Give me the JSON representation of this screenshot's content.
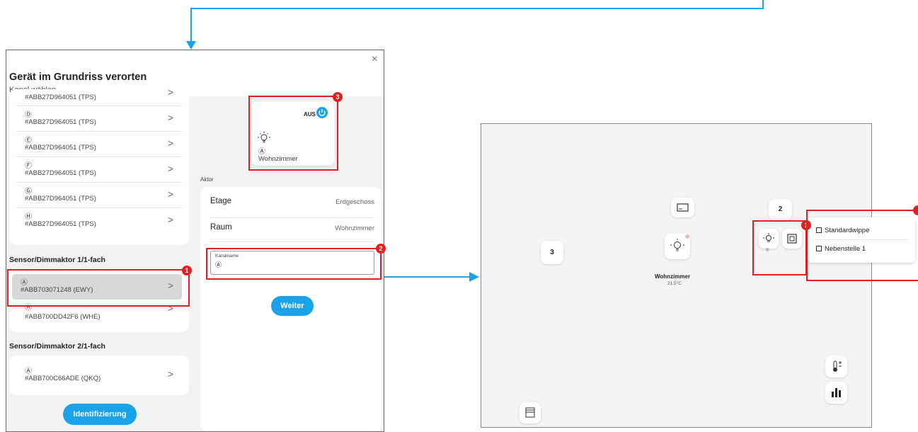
{
  "dialog": {
    "title": "Gerät im Grundriss verorten",
    "subtitle": "Kanal wählen",
    "close": "×"
  },
  "channel_list": {
    "top_partial_id": "#ABB27D964051 (TPS)",
    "group1_rows": [
      {
        "channel": "Ⓓ",
        "id": "#ABB27D964051 (TPS)"
      },
      {
        "channel": "Ⓔ",
        "id": "#ABB27D964051 (TPS)"
      },
      {
        "channel": "Ⓕ",
        "id": "#ABB27D964051 (TPS)"
      },
      {
        "channel": "Ⓖ",
        "id": "#ABB27D964051 (TPS)"
      },
      {
        "channel": "Ⓗ",
        "id": "#ABB27D964051 (TPS)"
      }
    ],
    "section2_title": "Sensor/Dimmaktor 1/1-fach",
    "group2_rows": [
      {
        "channel": "Ⓐ",
        "id": "#ABB703071248 (EWY)"
      },
      {
        "channel": "Ⓐ",
        "id": "#ABB700DD42F6 (WHE)"
      }
    ],
    "section3_title": "Sensor/Dimmaktor 2/1-fach",
    "group3_rows": [
      {
        "channel": "Ⓐ",
        "id": "#ABB700C66ADE (QKQ)"
      }
    ],
    "chevron": ">",
    "identify_button": "Identifizierung"
  },
  "preview": {
    "status": "AUS",
    "channel": "Ⓐ",
    "room": "Wohnzimmer"
  },
  "actor": {
    "label": "Aktor",
    "floor_label": "Etage",
    "floor_value": "Erdgeschoss",
    "room_label": "Raum",
    "room_value": "Wohnzimmer",
    "channel_name_label": "Kanalname",
    "channel_name_value": "Ⓐ",
    "next_button": "Weiter"
  },
  "badges": {
    "b1": "1",
    "b2": "2",
    "b3": "3"
  },
  "floorplan": {
    "room_name": "Wohnzimmer",
    "room_temp": "21.5°C",
    "tile_3": "3",
    "tile_2": "2",
    "sub_marker": "®",
    "popup_items": [
      "Standardwippe",
      "Nebenstelle 1"
    ]
  },
  "colors": {
    "accent": "#1aa3e8",
    "highlight": "#e02020",
    "active": "#1aa3e8"
  }
}
